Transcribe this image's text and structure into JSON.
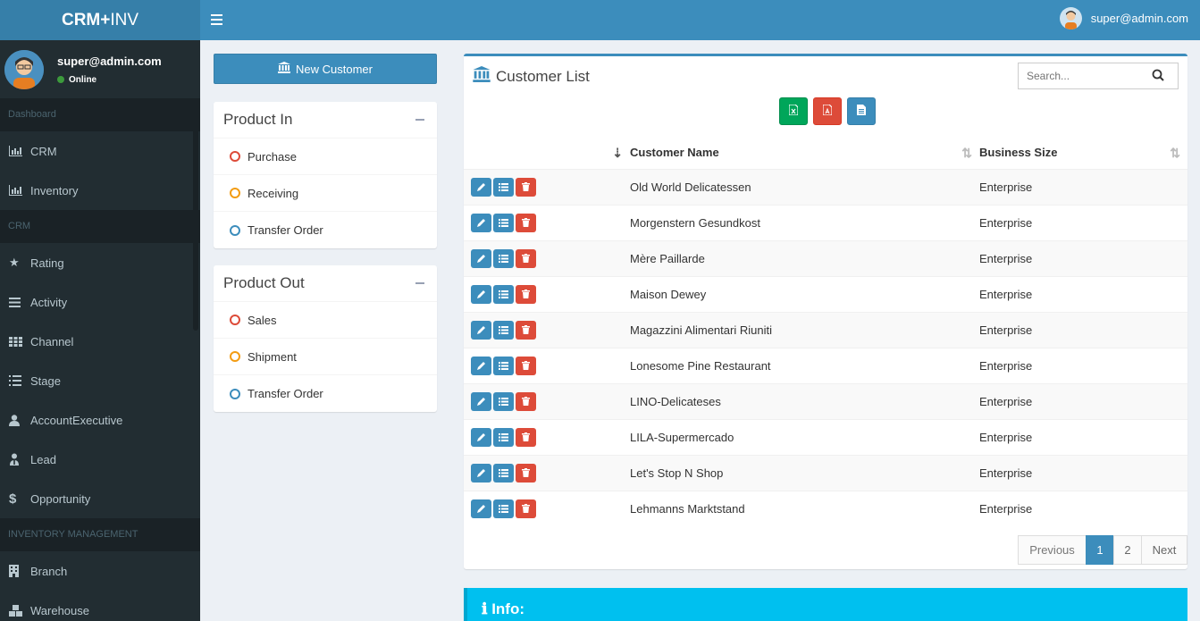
{
  "logo": {
    "bold": "CRM+",
    "light": "INV"
  },
  "navbar": {
    "user_email": "super@admin.com"
  },
  "sidebar": {
    "user": {
      "name": "super@admin.com",
      "status": "Online"
    },
    "sections": [
      {
        "header": "Dashboard",
        "items": [
          {
            "label": "CRM",
            "icon": "bar-chart-icon"
          },
          {
            "label": "Inventory",
            "icon": "bar-chart-icon"
          }
        ]
      },
      {
        "header": "CRM",
        "items": [
          {
            "label": "Rating",
            "icon": "star-icon"
          },
          {
            "label": "Activity",
            "icon": "list-icon"
          },
          {
            "label": "Channel",
            "icon": "grid-icon"
          },
          {
            "label": "Stage",
            "icon": "ordered-list-icon"
          },
          {
            "label": "AccountExecutive",
            "icon": "user-icon"
          },
          {
            "label": "Lead",
            "icon": "user-tie-icon"
          },
          {
            "label": "Opportunity",
            "icon": "dollar-icon"
          }
        ]
      },
      {
        "header": "INVENTORY MANAGEMENT",
        "items": [
          {
            "label": "Branch",
            "icon": "building-icon"
          },
          {
            "label": "Warehouse",
            "icon": "cubes-icon"
          }
        ]
      }
    ]
  },
  "new_customer_label": "New Customer",
  "product_in": {
    "title": "Product In",
    "items": [
      {
        "label": "Purchase",
        "color": "#dd4b39"
      },
      {
        "label": "Receiving",
        "color": "#f39c12"
      },
      {
        "label": "Transfer Order",
        "color": "#3c8dbc"
      }
    ]
  },
  "product_out": {
    "title": "Product Out",
    "items": [
      {
        "label": "Sales",
        "color": "#dd4b39"
      },
      {
        "label": "Shipment",
        "color": "#f39c12"
      },
      {
        "label": "Transfer Order",
        "color": "#3c8dbc"
      }
    ]
  },
  "customer_list": {
    "title": "Customer List",
    "search_placeholder": "Search...",
    "columns": {
      "name": "Customer Name",
      "size": "Business Size"
    },
    "rows": [
      {
        "name": "Old World Delicatessen",
        "size": "Enterprise"
      },
      {
        "name": "Morgenstern Gesundkost",
        "size": "Enterprise"
      },
      {
        "name": "Mère Paillarde",
        "size": "Enterprise"
      },
      {
        "name": "Maison Dewey",
        "size": "Enterprise"
      },
      {
        "name": "Magazzini Alimentari Riuniti",
        "size": "Enterprise"
      },
      {
        "name": "Lonesome Pine Restaurant",
        "size": "Enterprise"
      },
      {
        "name": "LINO-Delicateses",
        "size": "Enterprise"
      },
      {
        "name": "LILA-Supermercado",
        "size": "Enterprise"
      },
      {
        "name": "Let's Stop N Shop",
        "size": "Enterprise"
      },
      {
        "name": "Lehmanns Marktstand",
        "size": "Enterprise"
      }
    ],
    "pagination": {
      "previous": "Previous",
      "pages": [
        "1",
        "2"
      ],
      "active": "1",
      "next": "Next"
    }
  },
  "info_box": {
    "title": "Info:"
  },
  "colors": {
    "primary": "#3c8dbc",
    "sidebar": "#222d32",
    "danger": "#dd4b39",
    "success": "#00a65a",
    "info": "#00c0ef"
  }
}
